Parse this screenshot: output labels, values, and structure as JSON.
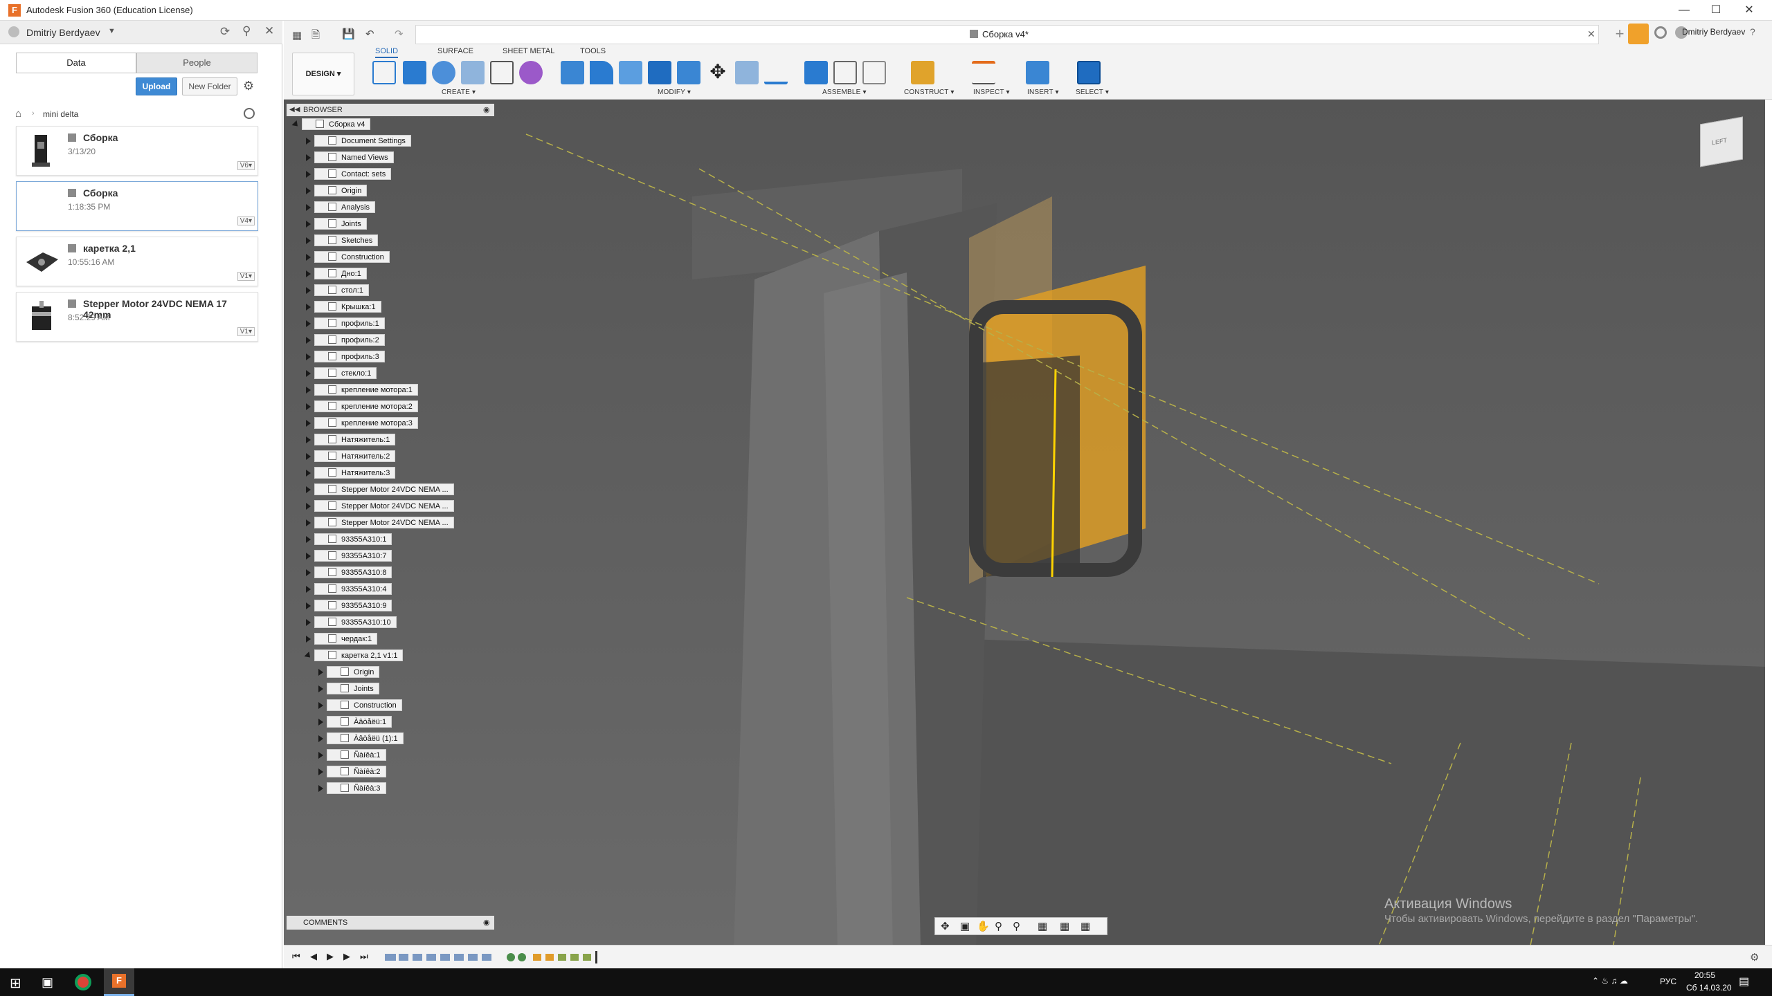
{
  "window": {
    "title": "Autodesk Fusion 360 (Education License)"
  },
  "user": {
    "name": "Dmitriy Berdyaev"
  },
  "data_panel": {
    "tabs": [
      "Data",
      "People"
    ],
    "upload": "Upload",
    "new_folder": "New Folder",
    "breadcrumb": "mini delta",
    "items": [
      {
        "name": "Сборка",
        "date": "3/13/20",
        "version": "V6▾"
      },
      {
        "name": "Сборка",
        "date": "1:18:35 PM",
        "version": "V4▾"
      },
      {
        "name": "каретка 2,1",
        "date": "10:55:16 AM",
        "version": "V1▾"
      },
      {
        "name": "Stepper Motor 24VDC NEMA 17 42mm",
        "date": "8:52:29 AM",
        "version": "V1▾"
      }
    ]
  },
  "doc_tab": {
    "title": "Сборка v4*"
  },
  "top_user": "Dmitriy Berdyaev",
  "workspace": {
    "design": "DESIGN ▾"
  },
  "toolbar_tabs": [
    "SOLID",
    "SURFACE",
    "SHEET METAL",
    "TOOLS"
  ],
  "toolbar_groups": [
    "CREATE ▾",
    "MODIFY ▾",
    "ASSEMBLE ▾",
    "CONSTRUCT ▾",
    "INSPECT ▾",
    "INSERT ▾",
    "SELECT ▾"
  ],
  "browser": {
    "title": "BROWSER",
    "root": "Сборка v4",
    "items": [
      "Document Settings",
      "Named Views",
      "Contact: sets",
      "Origin",
      "Analysis",
      "Joints",
      "Sketches",
      "Construction",
      "Дно:1",
      "стол:1",
      "Крышка:1",
      "профиль:1",
      "профиль:2",
      "профиль:3",
      "стекло:1",
      "крепление мотора:1",
      "крепление мотора:2",
      "крепление мотора:3",
      "Натяжитель:1",
      "Натяжитель:2",
      "Натяжитель:3",
      "Stepper Motor 24VDC NEMA ...",
      "Stepper Motor 24VDC NEMA ...",
      "Stepper Motor 24VDC NEMA ...",
      "93355A310:1",
      "93355A310:7",
      "93355A310:8",
      "93355A310:4",
      "93355A310:9",
      "93355A310:10",
      "чердак:1",
      "каретка 2,1 v1:1"
    ],
    "children": [
      "Origin",
      "Joints",
      "Construction",
      "Àâòåëü:1",
      "Àâòåëü (1):1",
      "Ñàíêà:1",
      "Ñàíêà:2",
      "Ñàíêà:3"
    ]
  },
  "comments": "COMMENTS",
  "viewcube": "LEFT",
  "watermark": {
    "line1": "Активация Windows",
    "line2": "Чтобы активировать Windows, перейдите в раздел \"Параметры\"."
  },
  "taskbar": {
    "time": "20:55",
    "date": "Сб 14.03.20",
    "lang": "РУС"
  }
}
